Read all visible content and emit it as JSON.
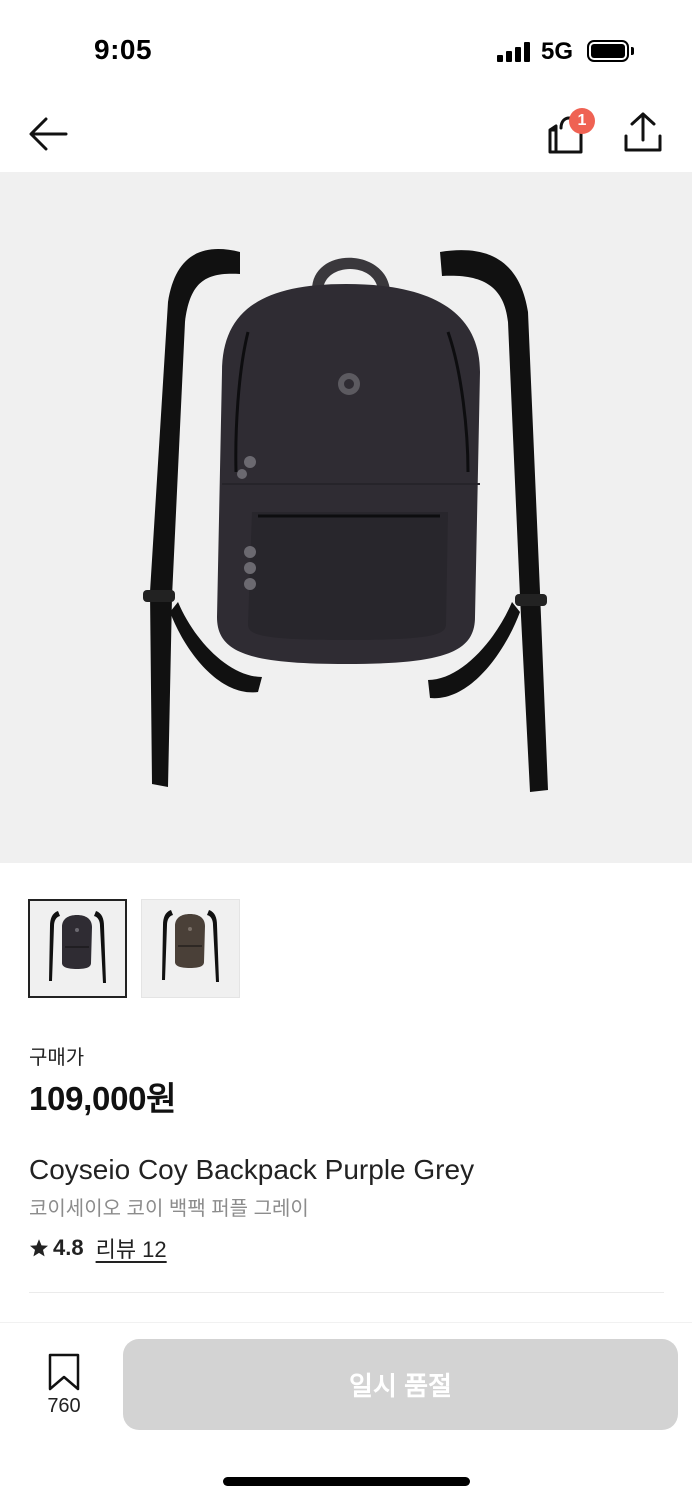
{
  "status_bar": {
    "time": "9:05",
    "network": "5G"
  },
  "header": {
    "back_icon": "arrow-left-icon",
    "cart_icon": "shopping-bag-icon",
    "cart_badge": "1",
    "share_icon": "share-upload-icon"
  },
  "product": {
    "images": [
      {
        "color": "purple-grey",
        "fill": "#2f2c33"
      },
      {
        "color": "brown",
        "fill": "#4a4038"
      }
    ],
    "price_label": "구매가",
    "price": "109,000원",
    "name": "Coyseio Coy Backpack Purple Grey",
    "name_ko": "코이세이오 코이 백팩 퍼플 그레이",
    "rating": "4.8",
    "review_link": "리뷰 12"
  },
  "bottom_bar": {
    "bookmark_icon": "bookmark-icon",
    "bookmark_count": "760",
    "action_label": "일시 품절"
  },
  "colors": {
    "badge": "#ef6253",
    "disabled_button": "#d3d3d3",
    "image_background": "#f0f0f0"
  }
}
